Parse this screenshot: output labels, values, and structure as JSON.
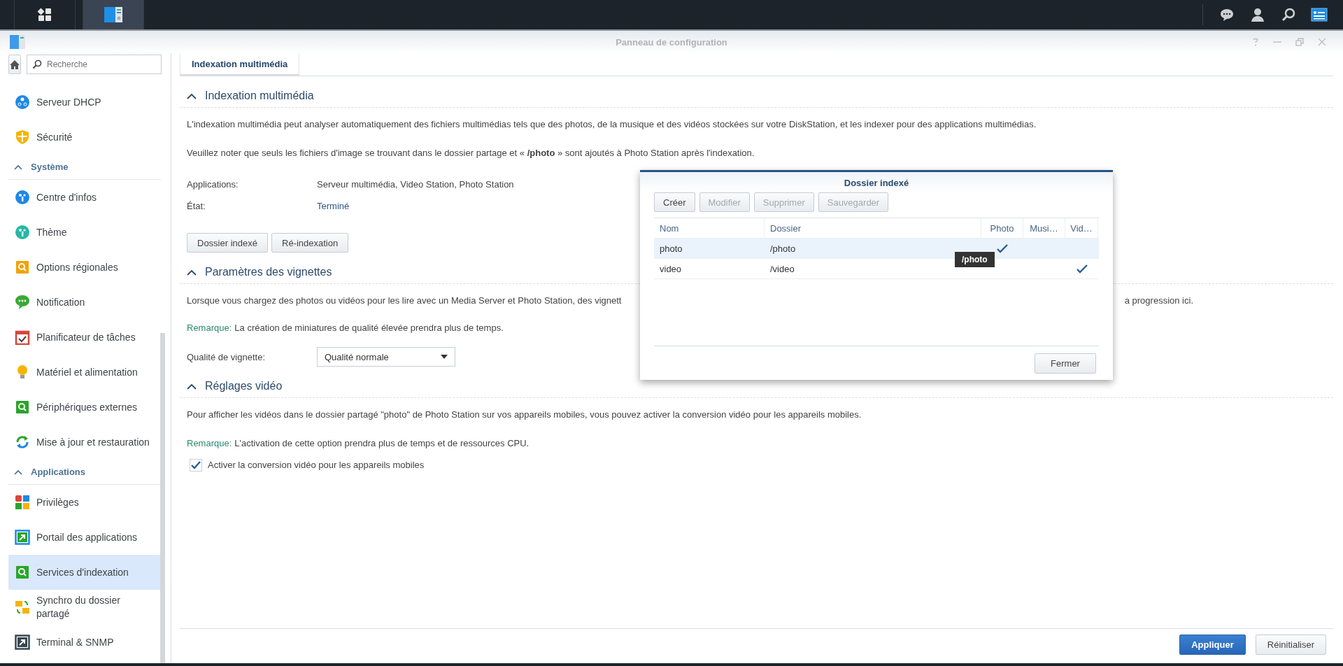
{
  "taskbar": {
    "apps": [
      {
        "kind": "grid",
        "selected": false
      },
      {
        "kind": "panel",
        "selected": true
      }
    ],
    "tray": [
      {
        "kind": "chat",
        "selected": false
      },
      {
        "kind": "user",
        "selected": false
      },
      {
        "kind": "search",
        "selected": false
      },
      {
        "kind": "widgets",
        "selected": true
      }
    ]
  },
  "window": {
    "title": "Panneau de configuration"
  },
  "sidebar": {
    "search": {
      "placeholder": "Recherche"
    },
    "top_items": [
      {
        "label": "Serveur DHCP",
        "selected": false
      },
      {
        "label": "Sécurité",
        "selected": false
      }
    ],
    "groups": [
      {
        "label": "Système",
        "expanded": true,
        "items": [
          {
            "label": "Centre d'infos",
            "selected": false
          },
          {
            "label": "Thème",
            "selected": false
          },
          {
            "label": "Options régionales",
            "selected": false
          },
          {
            "label": "Notification",
            "selected": false
          },
          {
            "label": "Planificateur de tâches",
            "selected": false
          },
          {
            "label": "Matériel et alimentation",
            "selected": false
          },
          {
            "label": "Périphériques externes",
            "selected": false
          },
          {
            "label": "Mise à jour et restauration",
            "selected": false
          }
        ]
      },
      {
        "label": "Applications",
        "expanded": true,
        "items": [
          {
            "label": "Privilèges",
            "selected": false
          },
          {
            "label": "Portail des applications",
            "selected": false
          },
          {
            "label": "Services d'indexation",
            "selected": true
          },
          {
            "label": "Synchro du dossier partagé",
            "selected": false
          },
          {
            "label": "Terminal & SNMP",
            "selected": false
          }
        ]
      }
    ]
  },
  "tabs": [
    {
      "label": "Indexation multimédia",
      "selected": true
    }
  ],
  "sections": [
    {
      "title": "Indexation multimédia",
      "expanded": true,
      "paragraphs": [
        "L'indexation multimédia peut analyser automatiquement des fichiers multimédias tels que des photos, de la musique et des vidéos stockées sur votre DiskStation, et les indexer pour des applications multimédias.",
        "Veuillez noter que seuls les fichiers d'image se trouvant dans le dossier partage et « **/photo** » sont ajoutés à Photo Station après l'indexation."
      ],
      "fields": [
        {
          "label": "Applications:",
          "value": "Serveur multimédia, Video Station, Photo Station",
          "kind": "plain"
        },
        {
          "label": "État:",
          "value": "Terminé",
          "kind": "status"
        }
      ],
      "buttons": [
        "Dossier indexé",
        "Ré-indexation"
      ]
    },
    {
      "title": "Paramètres des vignettes",
      "expanded": true,
      "split_paragraph": {
        "start": "Lorsque vous chargez des photos ou vidéos pour les lire avec un Media Server et Photo Station, des vignett",
        "end": "a progression ici."
      },
      "note": {
        "label": "Remarque:",
        "text": "La création de miniatures de qualité élevée prendra plus de temps."
      },
      "select": {
        "label": "Qualité de vignette:",
        "value": "Qualité normale"
      }
    },
    {
      "title": "Réglages vidéo",
      "expanded": true,
      "paragraphs": [
        "Pour afficher les vidéos dans le dossier partagé \"photo\" de Photo Station sur vos appareils mobiles, vous pouvez activer la conversion vidéo pour les appareils mobiles."
      ],
      "note": {
        "label": "Remarque:",
        "text": "L'activation de cette option prendra plus de temps et de ressources CPU."
      },
      "checkbox": {
        "label": "Activer la conversion vidéo pour les appareils mobiles",
        "checked": true
      }
    }
  ],
  "footer": {
    "buttons": [
      {
        "label": "Appliquer",
        "kind": "primary"
      },
      {
        "label": "Réinitialiser",
        "kind": "default"
      }
    ]
  },
  "dialog": {
    "title": "Dossier indexé",
    "toolbar": [
      {
        "label": "Créer",
        "disabled": false
      },
      {
        "label": "Modifier",
        "disabled": true
      },
      {
        "label": "Supprimer",
        "disabled": true
      },
      {
        "label": "Sauvegarder",
        "disabled": true
      }
    ],
    "columns": [
      "Nom",
      "Dossier",
      "Photo",
      "Musi…",
      "Vid…"
    ],
    "rows": [
      {
        "name": "photo",
        "folder": "/photo",
        "photo": true,
        "music": false,
        "video": false,
        "selected": true
      },
      {
        "name": "video",
        "folder": "/video",
        "photo": false,
        "music": false,
        "video": true,
        "selected": false
      }
    ],
    "tooltip": "/photo",
    "buttons": [
      "Fermer"
    ]
  }
}
